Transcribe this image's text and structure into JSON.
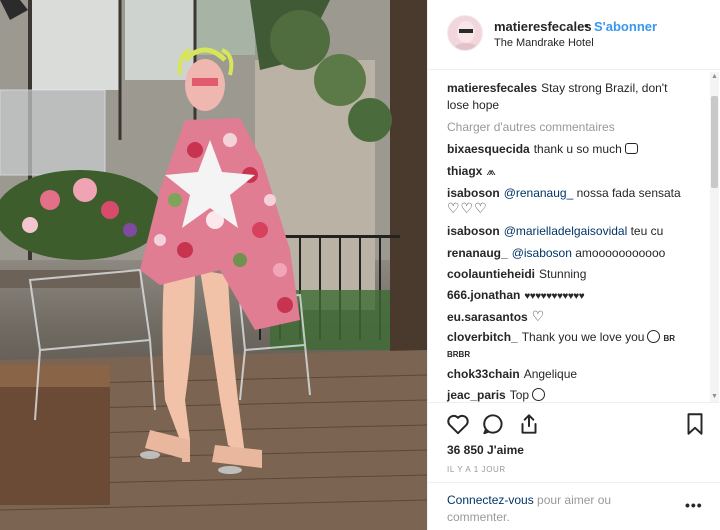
{
  "post_image": {
    "alt": ""
  },
  "header": {
    "username": "matieresfecales",
    "separator": "•",
    "follow_label": "S'abonner",
    "location": "The Mandrake Hotel"
  },
  "caption": {
    "username": "matieresfecales",
    "text_line1": "Stay strong Brazil, don't",
    "text_line2": "lose hope"
  },
  "load_more": "Charger d'autres commentaires",
  "comments": [
    {
      "username": "bixaesquecida",
      "text": "thank u so much"
    },
    {
      "username": "thiagx",
      "text": ""
    },
    {
      "username": "isaboson",
      "mention": "@renanaug_",
      "text": " nossa fada sensata",
      "text2": "♡♡♡"
    },
    {
      "username": "isaboson",
      "mention": "@marielladelgaisovidal",
      "text": " teu cu"
    },
    {
      "username": "renanaug_",
      "mention": "@isaboson",
      "text": " amooooooooooo"
    },
    {
      "username": "coolauntieheidi",
      "text": "Stunning"
    },
    {
      "username": "666.jonathan",
      "text": "♥♥♥♥♥♥♥♥♥♥♥"
    },
    {
      "username": "eu.sarasantos",
      "text": "♡"
    },
    {
      "username": "cloverbitch_",
      "text": "Thank you we love you",
      "tag": "BR",
      "text2": "BRBR"
    },
    {
      "username": "chok33chain",
      "text": "Angelique"
    },
    {
      "username": "jeac_paris",
      "text": "Top"
    }
  ],
  "actions": {
    "like_icon": "heart-icon",
    "comment_icon": "comment-icon",
    "share_icon": "share-icon",
    "save_icon": "bookmark-icon",
    "likes": "36 850 J'aime",
    "time": "IL Y A 1 JOUR"
  },
  "login": {
    "link": "Connectez-vous",
    "rest": " pour aimer ou",
    "line2": "commenter.",
    "more": "•••"
  },
  "colors": {
    "link_blue": "#3897f0",
    "mention": "#003569",
    "muted": "#999999",
    "text": "#262626"
  }
}
